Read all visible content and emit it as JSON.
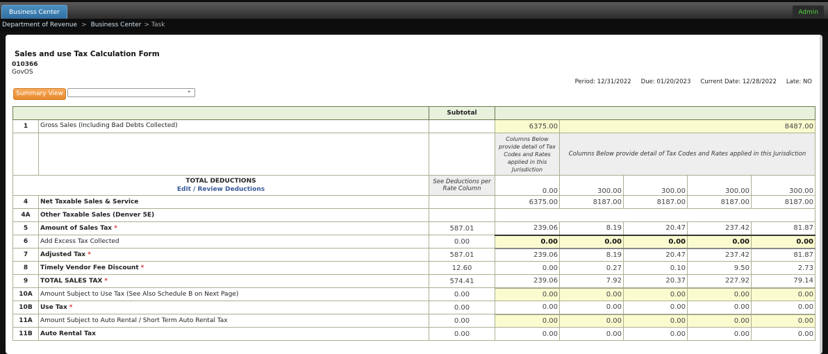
{
  "nav": {
    "tab": "Business Center",
    "admin": "Admin"
  },
  "breadcrumb": [
    "Department of Revenue",
    "Business Center",
    "Task"
  ],
  "form": {
    "title": "Sales and use Tax Calculation Form",
    "account": "010366",
    "org": "GovOS"
  },
  "toolbar": {
    "summary_label": "Summary View",
    "select_value": ""
  },
  "meta": {
    "period": "Period: 12/31/2022",
    "due": "Due: 01/20/2023",
    "current": "Current Date: 12/28/2022",
    "late": "Late: NO"
  },
  "table": {
    "subtotal_header": "Subtotal",
    "gross": {
      "num": "1",
      "label": "Gross Sales (Including Bad Debts Collected)",
      "col1": "6375.00",
      "rest": "8487.00"
    },
    "note_short": "Columns Below provide detail of Tax Codes and Rates applied in this Jurisdiction",
    "note_long": "Columns Below provide detail of Tax Codes and Rates applied in this Jurisdiction",
    "deductions": {
      "title": "TOTAL DEDUCTIONS",
      "edit": "Edit",
      "slash": " / ",
      "review": "Review Deductions",
      "see": "See Deductions per Rate Column",
      "values": [
        "0.00",
        "300.00",
        "300.00",
        "300.00",
        "300.00"
      ]
    },
    "rows": [
      {
        "num": "4",
        "label": "Net Taxable Sales & Service",
        "bold": true,
        "req": false,
        "sub": "",
        "values": [
          "6375.00",
          "8187.00",
          "8187.00",
          "8187.00",
          "8187.00"
        ],
        "kind": "plain"
      },
      {
        "num": "4A",
        "label": "Other Taxable Sales (Denver 5E)",
        "bold": true,
        "req": false,
        "sub": "",
        "values": [],
        "kind": "span"
      },
      {
        "num": "5",
        "label": "Amount of Sales Tax",
        "bold": true,
        "req": true,
        "sub": "587.01",
        "values": [
          "239.06",
          "8.19",
          "20.47",
          "237.42",
          "81.87"
        ],
        "kind": "plain"
      },
      {
        "num": "6",
        "label": "Add Excess Tax Collected",
        "bold": false,
        "req": false,
        "sub": "0.00",
        "values": [
          "0.00",
          "0.00",
          "0.00",
          "0.00",
          "0.00"
        ],
        "kind": "inp"
      },
      {
        "num": "7",
        "label": "Adjusted Tax",
        "bold": true,
        "req": true,
        "sub": "587.01",
        "values": [
          "239.06",
          "8.19",
          "20.47",
          "237.42",
          "81.87"
        ],
        "kind": "plain"
      },
      {
        "num": "8",
        "label": "Timely Vendor Fee Discount",
        "bold": true,
        "req": true,
        "sub": "12.60",
        "values": [
          "0.00",
          "0.27",
          "0.10",
          "9.50",
          "2.73"
        ],
        "kind": "plain"
      },
      {
        "num": "9",
        "label": "TOTAL SALES TAX",
        "bold": true,
        "req": true,
        "sub": "574.41",
        "values": [
          "239.06",
          "7.92",
          "20.37",
          "227.92",
          "79.14"
        ],
        "kind": "plain"
      },
      {
        "num": "10A",
        "label": "Amount Subject to Use Tax (See Also Schedule B on Next Page)",
        "bold": false,
        "req": false,
        "sub": "0.00",
        "values": [
          "0.00",
          "0.00",
          "0.00",
          "0.00",
          "0.00"
        ],
        "kind": "inp2"
      },
      {
        "num": "10B",
        "label": "Use Tax",
        "bold": true,
        "req": true,
        "sub": "0.00",
        "values": [
          "0.00",
          "0.00",
          "0.00",
          "0.00",
          "0.00"
        ],
        "kind": "plain"
      },
      {
        "num": "11A",
        "label": "Amount Subject to Auto Rental / Short Term Auto Rental Tax",
        "bold": false,
        "req": false,
        "sub": "0.00",
        "values": [
          "0.00",
          "0.00",
          "0.00",
          "0.00",
          "0.00"
        ],
        "kind": "inp2"
      },
      {
        "num": "11B",
        "label": "Auto Rental Tax",
        "bold": true,
        "req": false,
        "sub": "0.00",
        "values": [
          "0.00",
          "0.00",
          "0.00",
          "0.00",
          "0.00"
        ],
        "kind": "plain"
      }
    ],
    "required_mark": "*"
  }
}
